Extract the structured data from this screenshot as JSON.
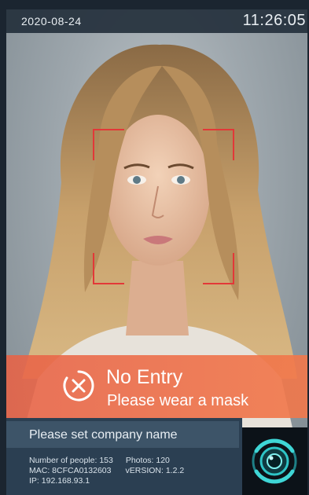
{
  "status_bar": {
    "date": "2020-08-24",
    "time": "11:26:05"
  },
  "alert": {
    "icon": "close-circle-icon",
    "title": "No Entry",
    "message": "Please wear a mask"
  },
  "info": {
    "company": "Please set company name",
    "people_label": "Number of people:",
    "people_count": "153",
    "photos_label": "Photos:",
    "photos_count": "120",
    "mac_label": "MAC:",
    "mac": "8CFCA0132603",
    "version_label": "vERSION:",
    "version": "1.2.2",
    "ip_label": "IP:",
    "ip": "192.168.93.1"
  },
  "logo": {
    "icon": "camera-lens-logo-icon"
  },
  "colors": {
    "alert_bg": "#ec6b4a",
    "face_frame": "#e23838",
    "panel": "#2b3f52",
    "logo_accent": "#2ec4c6"
  }
}
